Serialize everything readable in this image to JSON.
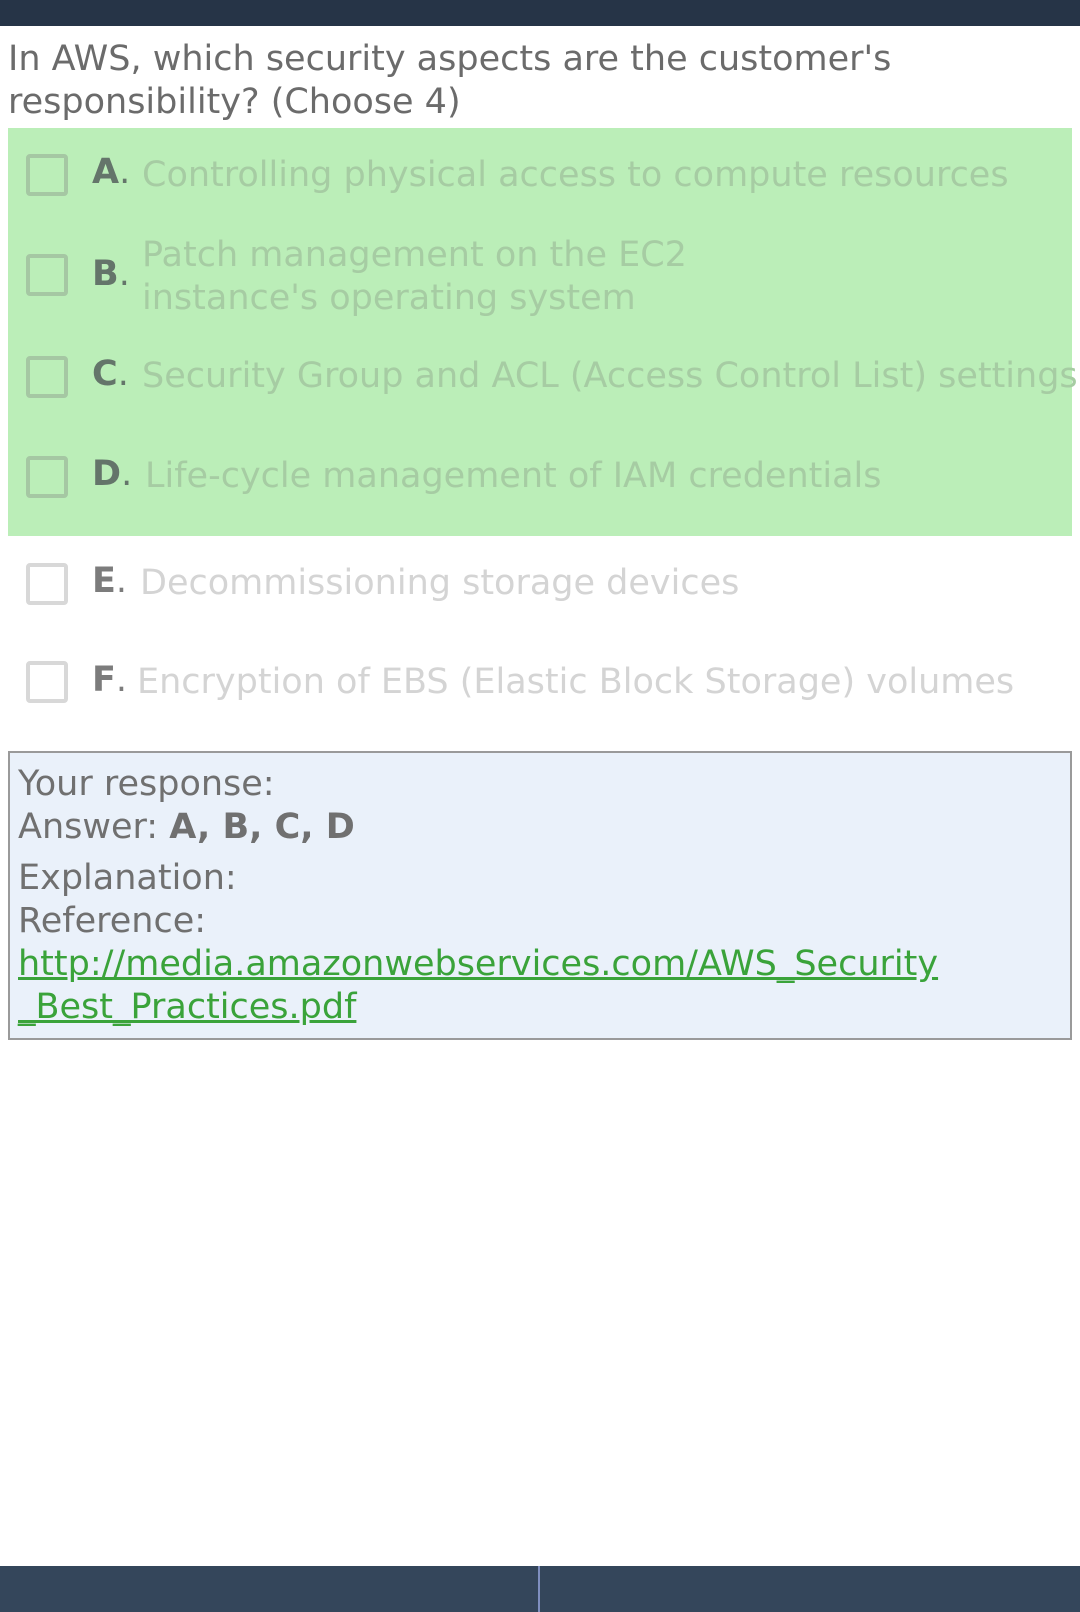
{
  "question": {
    "text": "In AWS, which security aspects are the customer's responsibility? (Choose 4)"
  },
  "options": [
    {
      "letter": "A",
      "text": "Controlling physical access to compute resources",
      "highlighted": true
    },
    {
      "letter": "B",
      "text": "Patch management on the EC2 instance's operating system",
      "highlighted": true
    },
    {
      "letter": "C",
      "text": "Security Group and ACL (Access Control List) settings",
      "highlighted": true
    },
    {
      "letter": "D",
      "text": "Life-cycle management of IAM credentials",
      "highlighted": true
    },
    {
      "letter": "E",
      "text": "Decommissioning storage devices",
      "highlighted": false
    },
    {
      "letter": "F",
      "text": "Encryption of EBS (Elastic Block Storage) volumes",
      "highlighted": false
    }
  ],
  "response": {
    "heading": "Your response:",
    "answer_label": "Answer:",
    "answer_value": "A, B, C, D",
    "explanation_label": "Explanation:",
    "reference_label": "Reference:",
    "reference_link": "http://media.amazonwebservices.com/AWS_Security_Best_Practices.pdf"
  },
  "colors": {
    "highlight_bg": "#bbeeb8",
    "response_bg": "#eaf1fa",
    "link": "#3aa33a",
    "bar": "#263447"
  }
}
